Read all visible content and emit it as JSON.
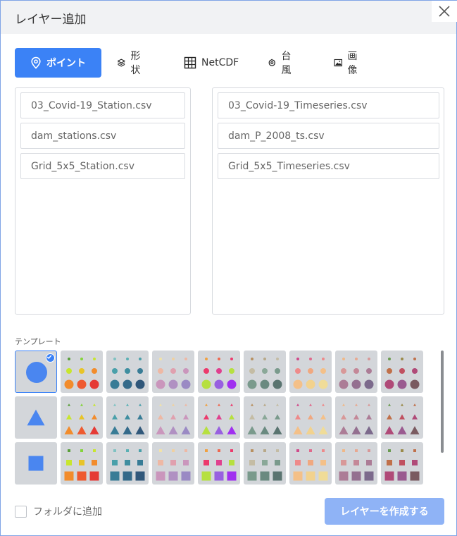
{
  "dialog": {
    "title": "レイヤー追加"
  },
  "tabs": [
    {
      "label": "ポイント",
      "icon": "map-pin-icon",
      "active": true
    },
    {
      "label": "形状",
      "icon": "layers-icon"
    },
    {
      "label": "NetCDF",
      "icon": "grid-icon"
    },
    {
      "label": "台風",
      "icon": "typhoon-icon"
    },
    {
      "label": "画像",
      "icon": "image-icon"
    }
  ],
  "station_files": [
    "03_Covid-19_Station.csv",
    "dam_stations.csv",
    "Grid_5x5_Station.csv"
  ],
  "timeseries_files": [
    "03_Covid-19_Timeseries.csv",
    "dam_P_2008_ts.csv",
    "Grid_5x5_Timeseries.csv"
  ],
  "templates": {
    "label": "テンプレート",
    "shapes": [
      "circle",
      "triangle",
      "square"
    ],
    "default_color": "#4a86f0",
    "palettes": [
      [
        "#5a9e3a",
        "#84d43a",
        "#c8e62e",
        "#e8c428",
        "#f28c2c",
        "#ee5a30",
        "#e53a35"
      ],
      [
        "#7fc2c2",
        "#5ab0b4",
        "#4aa0aa",
        "#3f8ea0",
        "#387c96",
        "#346a8a",
        "#30577a"
      ],
      [
        "#f1e2a8",
        "#f0d0a0",
        "#eeb8a4",
        "#e0a0ae",
        "#ca96bc",
        "#b090c2",
        "#9a8ac4"
      ],
      [
        "#f0a040",
        "#ee6850",
        "#ec3a6c",
        "#e0408e",
        "#b6e040",
        "#9860e0",
        "#a030f0"
      ],
      [
        "#b89060",
        "#b8a888",
        "#c4bca4",
        "#8aa898",
        "#7a9a8c",
        "#6a8a80",
        "#5a7470"
      ],
      [
        "#d04a8a",
        "#e06a8c",
        "#ee8a8a",
        "#f0a880",
        "#f4c088",
        "#f2d28e",
        "#f0dc98"
      ],
      [
        "#f0b888",
        "#e8a890",
        "#d89898",
        "#c48898",
        "#ac7c96",
        "#947090",
        "#7c6a8c"
      ],
      [
        "#6a9a50",
        "#9a8a4a",
        "#c0704a",
        "#c05060",
        "#b04a78",
        "#9a5a90",
        "#7a5a60"
      ]
    ]
  },
  "footer": {
    "folder_label": "フォルダに追加",
    "create_label": "レイヤーを作成する"
  }
}
